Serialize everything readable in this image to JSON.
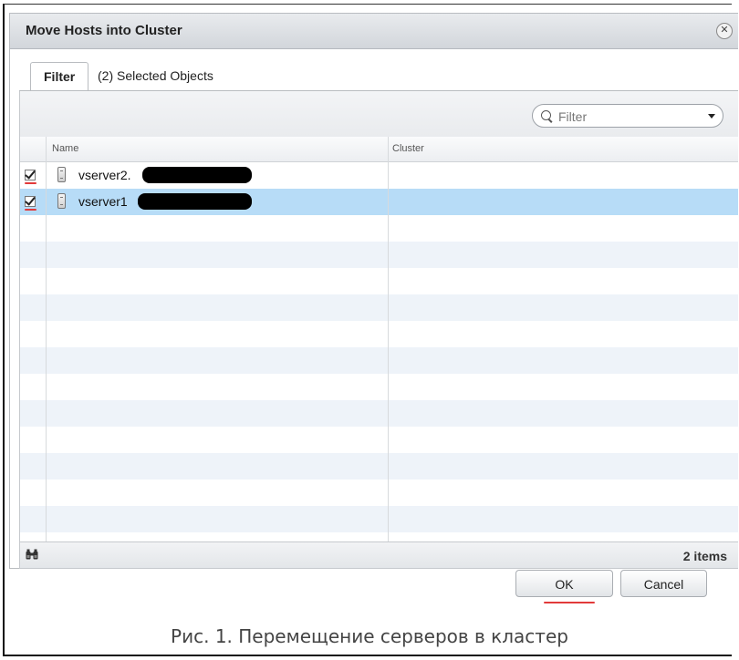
{
  "dialog": {
    "title": "Move Hosts into Cluster",
    "close_glyph": "✕"
  },
  "tabs": [
    {
      "label": "Filter",
      "active": true
    },
    {
      "label": "(2) Selected Objects",
      "active": false
    }
  ],
  "filter": {
    "placeholder": "Filter",
    "value": "",
    "icon": "search-icon"
  },
  "grid": {
    "columns": [
      "Name",
      "Cluster"
    ],
    "rows": [
      {
        "checked": true,
        "name": "vserver2.",
        "cluster": "",
        "selected": false,
        "icon": "server-icon"
      },
      {
        "checked": true,
        "name": "vserver1",
        "cluster": "",
        "selected": true,
        "icon": "server-icon"
      }
    ],
    "item_count": "2 items"
  },
  "buttons": {
    "ok": "OK",
    "cancel": "Cancel"
  },
  "caption": "Рис. 1. Перемещение серверов в кластер",
  "colors": {
    "selected_row": "#b7dcf7",
    "stripe_row": "#eef3f9",
    "annotation_red": "#e23a3a"
  }
}
